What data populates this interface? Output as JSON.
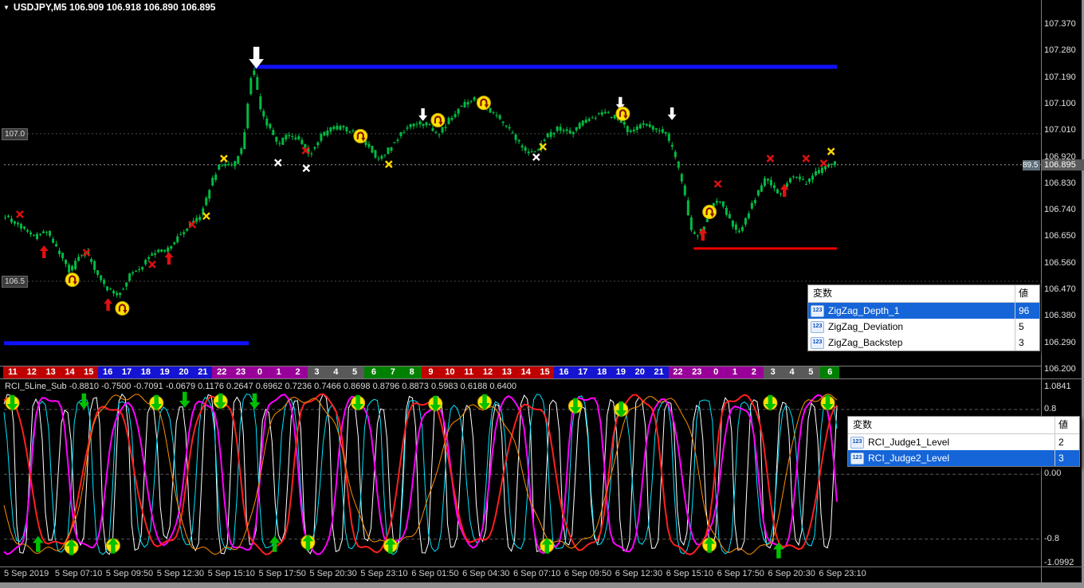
{
  "window": {
    "menu_icon": "▼",
    "app_kind": "MetaTrader chart window"
  },
  "main_chart": {
    "title": "USDJPY,M5 106.909 106.918 106.890 106.895",
    "symbol": "USDJPY,M5",
    "ohlc": {
      "open": "106.909",
      "high": "106.918",
      "low": "106.890",
      "close": "106.895"
    },
    "current_price_label": "106.895",
    "price_line_partial_label": "89.5",
    "left_tags": [
      {
        "label": "107.0"
      },
      {
        "label": "106.5"
      }
    ],
    "axis_labels": [
      "107.370",
      "107.280",
      "107.190",
      "107.100",
      "107.010",
      "106.920",
      "106.830",
      "106.740",
      "106.650",
      "106.560",
      "106.470",
      "106.380",
      "106.290",
      "106.200"
    ]
  },
  "indicator_header": "RCI_5Line_Sub -0.8810 -0.7500 -0.7091 -0.0679 0.1176 0.2647 0.6962 0.7236 0.7466 0.8698 0.8796 0.8873 0.5983 0.6188 0.6400",
  "rci_axis_labels": [
    {
      "label": "1.0841",
      "value": 1.0841
    },
    {
      "label": "0.8",
      "value": 0.8
    },
    {
      "label": "0.00",
      "value": 0.0
    },
    {
      "label": "-0.8",
      "value": -0.8
    },
    {
      "label": "-1.0992",
      "value": -1.0992
    }
  ],
  "chart_data": [
    {
      "type": "candlestick",
      "title": "USDJPY M5",
      "y_range": [
        106.2,
        107.37
      ],
      "y_tick_step": 0.09,
      "candle_color": "#00bb44",
      "price_anchors": [
        [
          0.003,
          106.72
        ],
        [
          0.024,
          106.68
        ],
        [
          0.038,
          106.65
        ],
        [
          0.053,
          106.67
        ],
        [
          0.067,
          106.6
        ],
        [
          0.081,
          106.53
        ],
        [
          0.091,
          106.58
        ],
        [
          0.1,
          106.6
        ],
        [
          0.11,
          106.55
        ],
        [
          0.124,
          106.48
        ],
        [
          0.139,
          106.45
        ],
        [
          0.153,
          106.52
        ],
        [
          0.167,
          106.55
        ],
        [
          0.182,
          106.6
        ],
        [
          0.196,
          106.6
        ],
        [
          0.211,
          106.65
        ],
        [
          0.225,
          106.69
        ],
        [
          0.239,
          106.72
        ],
        [
          0.252,
          106.84
        ],
        [
          0.263,
          106.9
        ],
        [
          0.278,
          106.89
        ],
        [
          0.29,
          106.96
        ],
        [
          0.298,
          107.18
        ],
        [
          0.303,
          107.21
        ],
        [
          0.311,
          107.08
        ],
        [
          0.321,
          107.02
        ],
        [
          0.332,
          106.96
        ],
        [
          0.344,
          107.0
        ],
        [
          0.357,
          106.98
        ],
        [
          0.37,
          106.93
        ],
        [
          0.383,
          106.99
        ],
        [
          0.397,
          107.02
        ],
        [
          0.411,
          107.02
        ],
        [
          0.426,
          107.0
        ],
        [
          0.44,
          106.96
        ],
        [
          0.454,
          106.91
        ],
        [
          0.469,
          106.96
        ],
        [
          0.483,
          107.01
        ],
        [
          0.498,
          107.04
        ],
        [
          0.512,
          107.03
        ],
        [
          0.526,
          107.0
        ],
        [
          0.541,
          107.06
        ],
        [
          0.555,
          107.1
        ],
        [
          0.569,
          107.12
        ],
        [
          0.584,
          107.09
        ],
        [
          0.598,
          107.05
        ],
        [
          0.612,
          107.01
        ],
        [
          0.627,
          106.95
        ],
        [
          0.641,
          106.93
        ],
        [
          0.655,
          106.99
        ],
        [
          0.67,
          107.02
        ],
        [
          0.684,
          107.0
        ],
        [
          0.699,
          107.04
        ],
        [
          0.713,
          107.06
        ],
        [
          0.727,
          107.07
        ],
        [
          0.742,
          107.05
        ],
        [
          0.756,
          107.0
        ],
        [
          0.77,
          107.03
        ],
        [
          0.785,
          107.02
        ],
        [
          0.799,
          107.0
        ],
        [
          0.81,
          106.93
        ],
        [
          0.82,
          106.82
        ],
        [
          0.83,
          106.67
        ],
        [
          0.837,
          106.65
        ],
        [
          0.847,
          106.7
        ],
        [
          0.856,
          106.76
        ],
        [
          0.866,
          106.77
        ],
        [
          0.876,
          106.71
        ],
        [
          0.887,
          106.66
        ],
        [
          0.898,
          106.73
        ],
        [
          0.91,
          106.8
        ],
        [
          0.92,
          106.85
        ],
        [
          0.929,
          106.81
        ],
        [
          0.939,
          106.8
        ],
        [
          0.948,
          106.85
        ],
        [
          0.958,
          106.86
        ],
        [
          0.967,
          106.83
        ],
        [
          0.977,
          106.86
        ],
        [
          0.987,
          106.88
        ],
        [
          1.0,
          106.9
        ]
      ],
      "lines": [
        {
          "name": "resistance-line",
          "color": "#1010ff",
          "price": 107.227,
          "x1": 0.301,
          "x2": 1.0,
          "width": 5,
          "style": "solid"
        },
        {
          "name": "old-support-line",
          "color": "#1010ff",
          "price": 106.29,
          "x1": 0.0,
          "x2": 0.294,
          "width": 5,
          "style": "solid"
        },
        {
          "name": "support-line",
          "color": "#ee0000",
          "price": 106.611,
          "x1": 0.828,
          "x2": 1.0,
          "width": 3,
          "style": "solid"
        },
        {
          "name": "bid-line",
          "color": "#9a9a9a",
          "price": 106.895,
          "x1": 0.0,
          "x2": 1.245,
          "width": 1,
          "style": "dotted"
        },
        {
          "name": "round-level-107.0",
          "color": "#464646",
          "price": 107.0,
          "x1": 0.0,
          "x2": 1.245,
          "width": 1,
          "style": "dotted"
        },
        {
          "name": "round-level-106.5",
          "color": "#464646",
          "price": 106.5,
          "x1": 0.0,
          "x2": 1.245,
          "width": 1,
          "style": "dotted"
        }
      ],
      "markers": [
        {
          "type": "x-red",
          "x": 0.019,
          "price": 106.727
        },
        {
          "type": "arrow-up-red",
          "x": 0.048,
          "price": 106.6
        },
        {
          "type": "uturn-yellow",
          "x": 0.082,
          "price": 106.505
        },
        {
          "type": "x-red",
          "x": 0.099,
          "price": 106.597
        },
        {
          "type": "arrow-up-red",
          "x": 0.125,
          "price": 106.421
        },
        {
          "type": "uturn-yellow",
          "x": 0.142,
          "price": 106.408
        },
        {
          "type": "x-red",
          "x": 0.178,
          "price": 106.557
        },
        {
          "type": "arrow-up-red",
          "x": 0.198,
          "price": 106.578
        },
        {
          "type": "x-red",
          "x": 0.226,
          "price": 106.692
        },
        {
          "type": "x-yellow",
          "x": 0.243,
          "price": 106.721
        },
        {
          "type": "x-yellow",
          "x": 0.264,
          "price": 106.916
        },
        {
          "type": "arrow-down-white-big",
          "x": 0.303,
          "price": 107.258
        },
        {
          "type": "x-white",
          "x": 0.329,
          "price": 106.902
        },
        {
          "type": "x-red",
          "x": 0.362,
          "price": 106.943
        },
        {
          "type": "x-white",
          "x": 0.363,
          "price": 106.883
        },
        {
          "type": "uturn-yellow",
          "x": 0.428,
          "price": 106.992
        },
        {
          "type": "x-yellow",
          "x": 0.462,
          "price": 106.897
        },
        {
          "type": "arrow-down-white",
          "x": 0.503,
          "price": 107.065
        },
        {
          "type": "uturn-yellow",
          "x": 0.521,
          "price": 107.046
        },
        {
          "type": "uturn-yellow",
          "x": 0.576,
          "price": 107.105
        },
        {
          "type": "x-white",
          "x": 0.639,
          "price": 106.921
        },
        {
          "type": "x-yellow",
          "x": 0.647,
          "price": 106.956
        },
        {
          "type": "arrow-down-white",
          "x": 0.74,
          "price": 107.103
        },
        {
          "type": "uturn-yellow",
          "x": 0.743,
          "price": 107.068
        },
        {
          "type": "arrow-down-white",
          "x": 0.802,
          "price": 107.068
        },
        {
          "type": "arrow-up-red",
          "x": 0.839,
          "price": 106.659
        },
        {
          "type": "uturn-yellow",
          "x": 0.847,
          "price": 106.735
        },
        {
          "type": "x-red",
          "x": 0.857,
          "price": 106.83
        },
        {
          "type": "x-red",
          "x": 0.92,
          "price": 106.916
        },
        {
          "type": "arrow-up-red",
          "x": 0.937,
          "price": 106.808
        },
        {
          "type": "x-red",
          "x": 0.963,
          "price": 106.916
        },
        {
          "type": "x-red",
          "x": 0.984,
          "price": 106.9
        },
        {
          "type": "x-yellow",
          "x": 0.993,
          "price": 106.94
        }
      ]
    },
    {
      "type": "line",
      "title": "RCI_5Line_Sub",
      "y_range": [
        -1.0992,
        1.0841
      ],
      "levels": [
        0.8,
        0.0,
        -0.8
      ],
      "current_values": [
        -0.881,
        -0.75,
        -0.7091,
        -0.0679,
        0.1176,
        0.2647,
        0.6962,
        0.7236,
        0.7466,
        0.8698,
        0.8796,
        0.8873,
        0.5983,
        0.6188,
        0.64
      ],
      "series": [
        {
          "name": "RCI-short",
          "color": "#ffffff",
          "width": 1,
          "period": 9,
          "phase": 0.7
        },
        {
          "name": "RCI-mid1",
          "color": "#00e5ff",
          "width": 1,
          "period": 13,
          "phase": 2.3
        },
        {
          "name": "RCI-mid2",
          "color": "#ff00ff",
          "width": 2,
          "period": 24,
          "phase": 4.1
        },
        {
          "name": "RCI-long1",
          "color": "#ff2020",
          "width": 2,
          "period": 33,
          "phase": 1.6
        },
        {
          "name": "RCI-long2",
          "color": "#ff9000",
          "width": 1,
          "period": 55,
          "phase": 3.4
        }
      ],
      "markers": [
        {
          "type": "circle-arrow-down",
          "x": 0.01,
          "value": 0.88
        },
        {
          "type": "arrow-down-green",
          "x": 0.096,
          "value": 0.9
        },
        {
          "type": "circle-arrow-down",
          "x": 0.183,
          "value": 0.88
        },
        {
          "type": "arrow-down-green",
          "x": 0.217,
          "value": 0.92
        },
        {
          "type": "circle-arrow-down",
          "x": 0.26,
          "value": 0.9
        },
        {
          "type": "arrow-down-green",
          "x": 0.301,
          "value": 0.9
        },
        {
          "type": "circle-arrow-down",
          "x": 0.425,
          "value": 0.88
        },
        {
          "type": "circle-arrow-down",
          "x": 0.518,
          "value": 0.87
        },
        {
          "type": "circle-arrow-down",
          "x": 0.577,
          "value": 0.89
        },
        {
          "type": "circle-arrow-down",
          "x": 0.686,
          "value": 0.84
        },
        {
          "type": "circle-arrow-down",
          "x": 0.741,
          "value": 0.8
        },
        {
          "type": "circle-arrow-down",
          "x": 0.92,
          "value": 0.88
        },
        {
          "type": "circle-arrow-down",
          "x": 0.989,
          "value": 0.88
        },
        {
          "type": "arrow-up-green",
          "x": 0.041,
          "value": -0.86
        },
        {
          "type": "circle-arrow-up",
          "x": 0.081,
          "value": -0.9
        },
        {
          "type": "circle-arrow-up",
          "x": 0.131,
          "value": -0.88
        },
        {
          "type": "arrow-up-green",
          "x": 0.325,
          "value": -0.86
        },
        {
          "type": "circle-arrow-up",
          "x": 0.365,
          "value": -0.84
        },
        {
          "type": "circle-arrow-up",
          "x": 0.464,
          "value": -0.88
        },
        {
          "type": "circle-arrow-up",
          "x": 0.652,
          "value": -0.88
        },
        {
          "type": "circle-arrow-up",
          "x": 0.847,
          "value": -0.87
        },
        {
          "type": "arrow-up-green",
          "x": 0.93,
          "value": -0.94
        }
      ]
    }
  ],
  "hour_ribbon": {
    "palette": {
      "red": "#c00000",
      "blue": "#1414d2",
      "purple": "#990099",
      "gray": "#595959",
      "green": "#008000"
    },
    "cells": [
      [
        "11",
        "red"
      ],
      [
        "12",
        "red"
      ],
      [
        "13",
        "red"
      ],
      [
        "14",
        "red"
      ],
      [
        "15",
        "red"
      ],
      [
        "16",
        "blue"
      ],
      [
        "17",
        "blue"
      ],
      [
        "18",
        "blue"
      ],
      [
        "19",
        "blue"
      ],
      [
        "20",
        "blue"
      ],
      [
        "21",
        "blue"
      ],
      [
        "22",
        "purple"
      ],
      [
        "23",
        "purple"
      ],
      [
        "0",
        "purple"
      ],
      [
        "1",
        "purple"
      ],
      [
        "2",
        "purple"
      ],
      [
        "3",
        "gray"
      ],
      [
        "4",
        "gray"
      ],
      [
        "5",
        "gray"
      ],
      [
        "6",
        "green"
      ],
      [
        "7",
        "green"
      ],
      [
        "8",
        "green"
      ],
      [
        "9",
        "red"
      ],
      [
        "10",
        "red"
      ],
      [
        "11",
        "red"
      ],
      [
        "12",
        "red"
      ],
      [
        "13",
        "red"
      ],
      [
        "14",
        "red"
      ],
      [
        "15",
        "red"
      ],
      [
        "16",
        "blue"
      ],
      [
        "17",
        "blue"
      ],
      [
        "18",
        "blue"
      ],
      [
        "19",
        "blue"
      ],
      [
        "20",
        "blue"
      ],
      [
        "21",
        "blue"
      ],
      [
        "22",
        "purple"
      ],
      [
        "23",
        "purple"
      ],
      [
        "0",
        "purple"
      ],
      [
        "1",
        "purple"
      ],
      [
        "2",
        "purple"
      ],
      [
        "3",
        "gray"
      ],
      [
        "4",
        "gray"
      ],
      [
        "5",
        "gray"
      ],
      [
        "6",
        "green"
      ]
    ]
  },
  "time_axis": [
    "5 Sep 2019",
    "5 Sep 07:10",
    "5 Sep 09:50",
    "5 Sep 12:30",
    "5 Sep 15:10",
    "5 Sep 17:50",
    "5 Sep 20:30",
    "5 Sep 23:10",
    "6 Sep 01:50",
    "6 Sep 04:30",
    "6 Sep 07:10",
    "6 Sep 09:50",
    "6 Sep 12:30",
    "6 Sep 15:10",
    "6 Sep 17:50",
    "6 Sep 20:30",
    "6 Sep 23:10"
  ],
  "popups": [
    {
      "name": "zigzag-parameters",
      "header": {
        "name": "変数",
        "value": "値"
      },
      "rows": [
        {
          "icon": "123",
          "name": "ZigZag_Depth_1",
          "value": "96",
          "selected": true
        },
        {
          "icon": "123",
          "name": "ZigZag_Deviation",
          "value": "5",
          "selected": false
        },
        {
          "icon": "123",
          "name": "ZigZag_Backstep",
          "value": "3",
          "selected": false
        }
      ]
    },
    {
      "name": "rci-parameters",
      "header": {
        "name": "変数",
        "value": "値"
      },
      "rows": [
        {
          "icon": "123",
          "name": "RCI_Judge1_Level",
          "value": "2",
          "selected": false
        },
        {
          "icon": "123",
          "name": "RCI_Judge2_Level",
          "value": "3",
          "selected": true
        }
      ]
    }
  ],
  "colors": {
    "background": "#000000",
    "candle": "#00bb44",
    "trend_blue": "#1010ff",
    "trend_red": "#ee0000",
    "selection_blue": "#1565d8",
    "marker_yellow": "#ffe400",
    "marker_green": "#00c000",
    "axis_text": "#e0e0e0"
  }
}
